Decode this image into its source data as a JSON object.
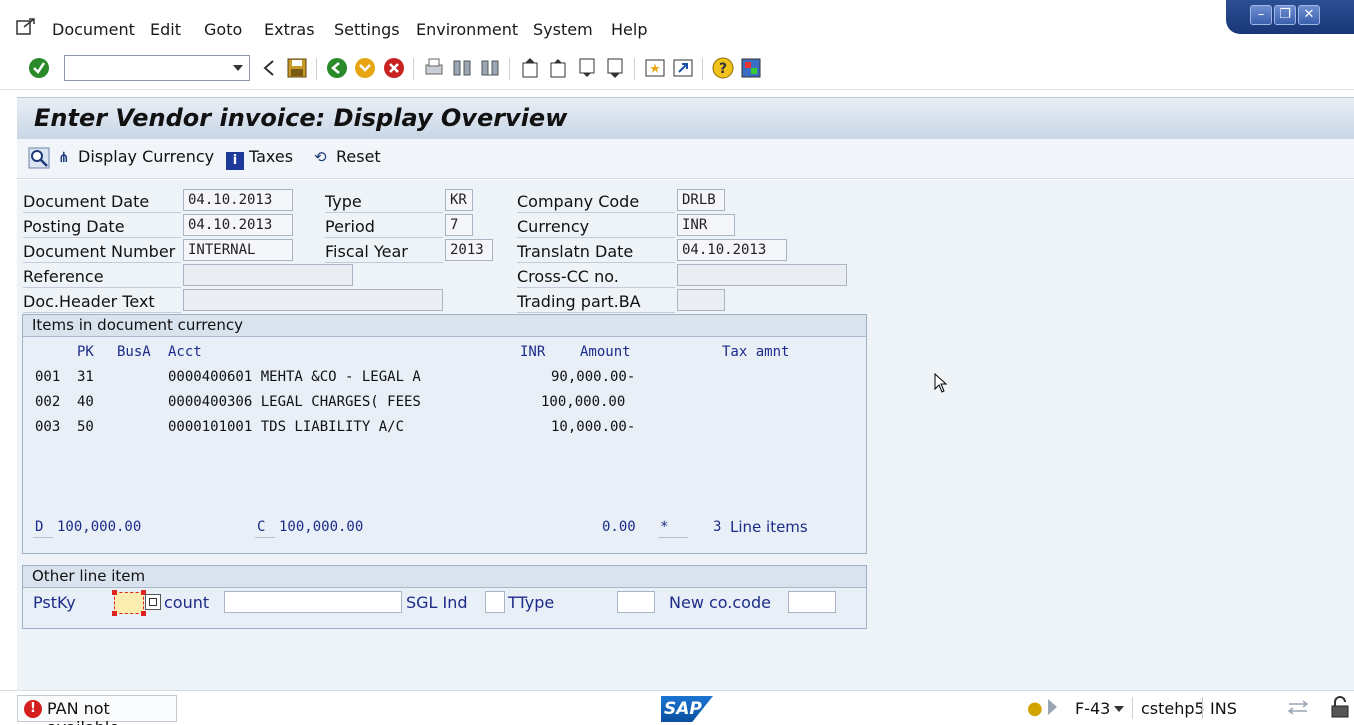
{
  "menu": {
    "items": [
      "Document",
      "Edit",
      "Goto",
      "Extras",
      "Settings",
      "Environment",
      "System",
      "Help"
    ]
  },
  "toolbar": {
    "command_value": "",
    "icons": [
      "enter-check-icon",
      "command-dropdown-icon",
      "back-arrow-icon",
      "save-icon",
      "back-icon",
      "exit-icon",
      "cancel-icon",
      "print-icon",
      "find-icon",
      "find-next-icon",
      "first-page-icon",
      "prev-page-icon",
      "next-page-icon",
      "last-page-icon",
      "new-session-icon",
      "shortcut-icon",
      "help-icon",
      "customize-layout-icon"
    ]
  },
  "title": "Enter Vendor invoice: Display Overview",
  "app_toolbar": {
    "display_currency": "Display Currency",
    "taxes": "Taxes",
    "reset": "Reset"
  },
  "header": {
    "document_date": {
      "label": "Document Date",
      "value": "04.10.2013"
    },
    "posting_date": {
      "label": "Posting Date",
      "value": "04.10.2013"
    },
    "document_number": {
      "label": "Document Number",
      "value": "INTERNAL"
    },
    "reference": {
      "label": "Reference",
      "value": ""
    },
    "doc_header_text": {
      "label": "Doc.Header Text",
      "value": ""
    },
    "type": {
      "label": "Type",
      "value": "KR"
    },
    "period": {
      "label": "Period",
      "value": "7"
    },
    "fiscal_year": {
      "label": "Fiscal Year",
      "value": "2013"
    },
    "company_code": {
      "label": "Company Code",
      "value": "DRLB"
    },
    "currency": {
      "label": "Currency",
      "value": "INR"
    },
    "translatn_date": {
      "label": "Translatn Date",
      "value": "04.10.2013"
    },
    "cross_cc": {
      "label": "Cross-CC no.",
      "value": ""
    },
    "trading_part": {
      "label": "Trading part.BA",
      "value": ""
    }
  },
  "items": {
    "group_title": "Items in document currency",
    "columns": {
      "pk": "PK",
      "busa": "BusA",
      "acct": "Acct",
      "currency": "INR",
      "amount": "Amount",
      "tax": "Tax amnt"
    },
    "rows": [
      {
        "no": "001",
        "pk": "31",
        "acct": "0000400601 MEHTA &CO - LEGAL A",
        "amount": "90,000.00-"
      },
      {
        "no": "002",
        "pk": "40",
        "acct": "0000400306 LEGAL CHARGES( FEES",
        "amount": "100,000.00"
      },
      {
        "no": "003",
        "pk": "50",
        "acct": "0000101001 TDS LIABILITY A/C",
        "amount": "10,000.00-"
      }
    ],
    "totals": {
      "d_label": "D",
      "d_value": "100,000.00",
      "c_label": "C",
      "c_value": "100,000.00",
      "balance": "0.00",
      "star": "*",
      "count": "3",
      "line_items": "Line items"
    }
  },
  "other_line": {
    "group_title": "Other line item",
    "pstky": "PstKy",
    "account": "count",
    "sgl_ind": "SGL Ind",
    "ttype": "TType",
    "new_co_code": "New co.code"
  },
  "status": {
    "message": "PAN not available",
    "transaction": "F-43",
    "server": "cstehp5",
    "mode": "INS",
    "logo": "SAP"
  }
}
